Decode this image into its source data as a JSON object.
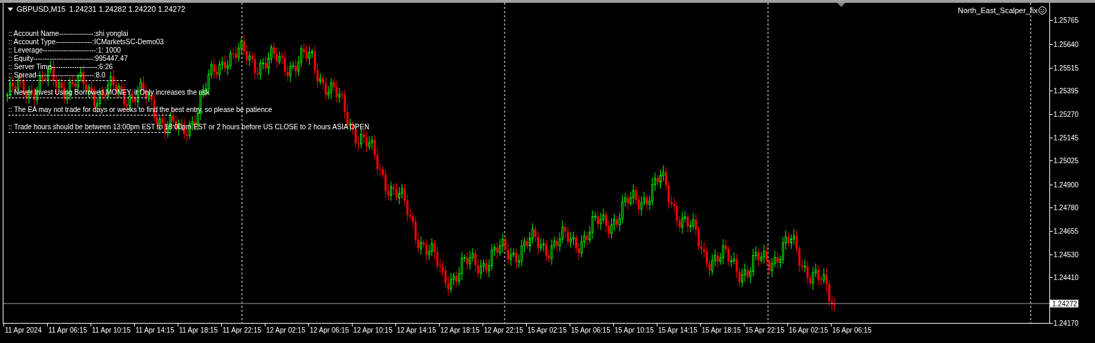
{
  "header": {
    "symbol": "GBPUSD,M15",
    "quote": "1.24231 1.24282 1.24220 1.24272"
  },
  "expert_label": "North_East_Scalper_fix",
  "info_panel": {
    "lines": [
      ":: Account Name---------------:shi yonglai",
      ":: Account Type----------------:ICMarketsSC-Demo03",
      ":: Leverage-----------------------:1: 1000",
      ":: Equity--------------------------:995447.47",
      ":: Server Time--------------------:6:26",
      ":: Spread-------------------------:8.0"
    ],
    "notes": [
      ":: Never Invest Using Borrowed MONEY, it Only increases the risk",
      ":: The EA may not trade for days or weeks to find the best entry, so please be patience",
      ":: Trade hours should be between 13:00pm EST to 18:00pm EST or 2 hours before US CLOSE to 2 hours ASIA OPEN"
    ]
  },
  "current_price": "1.24272",
  "price_axis": {
    "labels": [
      "1.25765",
      "1.25640",
      "1.25515",
      "1.25395",
      "1.25270",
      "1.25145",
      "1.25025",
      "1.24900",
      "1.24780",
      "1.24655",
      "1.24530",
      "1.24410",
      "1.24170"
    ]
  },
  "time_axis": {
    "labels": [
      "11 Apr 2024",
      "11 Apr 06:15",
      "11 Apr 10:15",
      "11 Apr 14:15",
      "11 Apr 18:15",
      "11 Apr 22:15",
      "12 Apr 02:15",
      "12 Apr 06:15",
      "12 Apr 10:15",
      "12 Apr 14:15",
      "12 Apr 18:15",
      "12 Apr 22:15",
      "15 Apr 02:15",
      "15 Apr 06:15",
      "15 Apr 10:15",
      "15 Apr 14:15",
      "15 Apr 18:15",
      "15 Apr 22:15",
      "16 Apr 02:15",
      "16 Apr 06:15"
    ]
  }
}
